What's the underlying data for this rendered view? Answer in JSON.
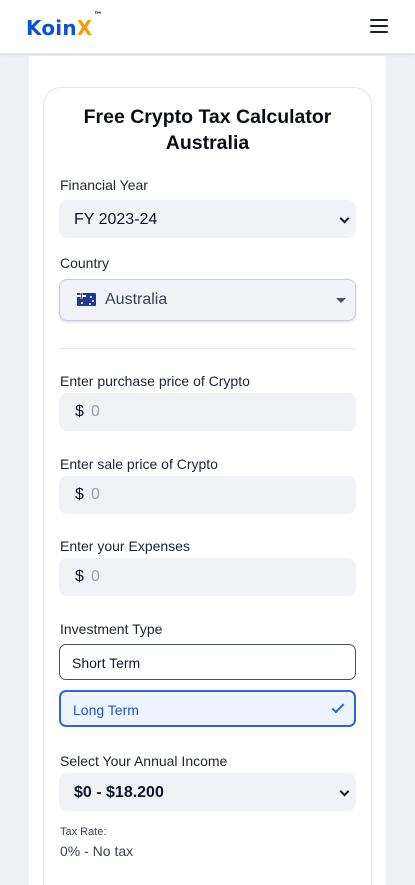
{
  "header": {
    "logo_main": "Koin",
    "logo_x": "X",
    "logo_tm": "™",
    "menu_icon": "hamburger-menu-icon"
  },
  "form": {
    "title_line1": "Free Crypto Tax Calculator",
    "title_line2": "Australia",
    "financial_year": {
      "label": "Financial Year",
      "value": "FY 2023-24"
    },
    "country": {
      "label": "Country",
      "value": "Australia",
      "flag_icon": "australia-flag-icon"
    },
    "purchase": {
      "label": "Enter purchase price of Crypto",
      "currency": "$",
      "placeholder": "0"
    },
    "sale": {
      "label": "Enter sale price of Crypto",
      "currency": "$",
      "placeholder": "0"
    },
    "expenses": {
      "label": "Enter your Expenses",
      "currency": "$",
      "placeholder": "0"
    },
    "investment_type": {
      "label": "Investment Type",
      "options": [
        "Short Term",
        "Long Term"
      ],
      "selected": "Long Term"
    },
    "annual_income": {
      "label": "Select Your Annual Income",
      "value": "$0 - $18.200"
    },
    "tax_rate": {
      "label": "Tax Rate:",
      "value": "0% - No tax"
    }
  },
  "colors": {
    "brand_blue": "#0b52d6",
    "brand_orange": "#f59e0b",
    "selected_border": "#2c67d8",
    "field_bg": "#f0f2f5"
  }
}
